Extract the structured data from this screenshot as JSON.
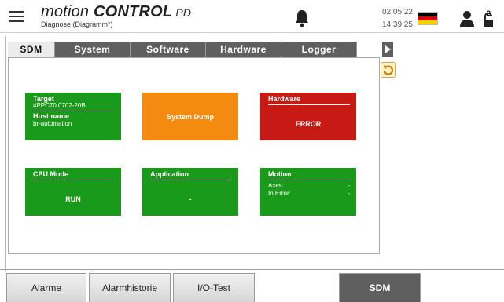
{
  "header": {
    "brand_prefix": "motion ",
    "brand_bold": "CONTROL",
    "brand_suffix": " PD",
    "subtitle": "Diagnose (Diagramm*)",
    "date": "02.05.22",
    "time": "14:39:25",
    "user_level": "2",
    "flag_colors": [
      "#000000",
      "#dd0000",
      "#ffce00"
    ]
  },
  "tabs": [
    {
      "label": "SDM",
      "active": true
    },
    {
      "label": "System",
      "active": false
    },
    {
      "label": "Software",
      "active": false
    },
    {
      "label": "Hardware",
      "active": false
    },
    {
      "label": "Logger",
      "active": false
    }
  ],
  "tiles": {
    "target": {
      "title": "Target",
      "model": "4PPC70.0702-20B",
      "host_label": "Host name",
      "host_value": "br-automation",
      "color": "#1a9a1a"
    },
    "system_dump": {
      "label": "System Dump",
      "color": "#f58a10"
    },
    "hardware": {
      "title": "Hardware",
      "status": "ERROR",
      "color": "#c81a15"
    },
    "cpu_mode": {
      "title": "CPU Mode",
      "status": "RUN",
      "color": "#1a9a1a"
    },
    "application": {
      "title": "Application",
      "status": "-",
      "color": "#1a9a1a"
    },
    "motion": {
      "title": "Motion",
      "axes_label": "Axes:",
      "axes_value": "-",
      "error_label": "In Error:",
      "error_value": "-",
      "color": "#1a9a1a"
    }
  },
  "bottom_nav": [
    {
      "label": "Alarme",
      "active": false
    },
    {
      "label": "Alarmhistorie",
      "active": false
    },
    {
      "label": "I/O-Test",
      "active": false
    },
    {
      "label": "SDM",
      "active": true
    }
  ],
  "icons": {
    "menu": "hamburger-menu-icon",
    "bell": "bell-icon",
    "flag": "german-flag-icon",
    "user": "user-icon",
    "lock": "lock-open-icon",
    "refresh": "refresh-icon",
    "tab_scroll": "chevron-right-icon"
  }
}
